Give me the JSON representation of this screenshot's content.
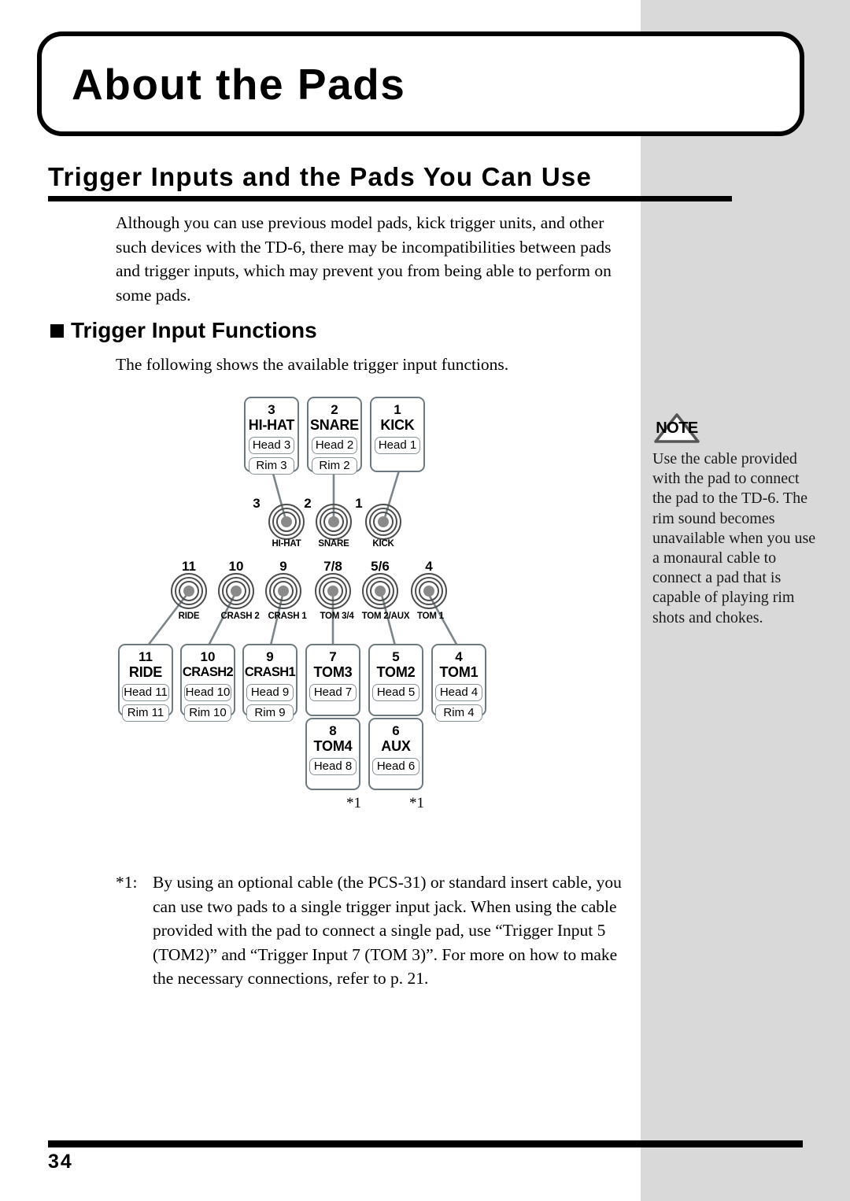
{
  "page": {
    "chapter_title": "About the Pads",
    "section_title": "Trigger Inputs and the Pads You Can Use",
    "page_number": "34"
  },
  "intro": {
    "paragraph": "Although you can use previous model pads, kick trigger units, and other such devices with the TD-6, there may be incompatibilities between pads and trigger inputs, which may prevent you from being able to perform on some pads."
  },
  "subsection": {
    "heading": "Trigger Input Functions",
    "paragraph": "The following shows the available trigger input functions."
  },
  "note": {
    "icon_label": "NOTE",
    "text": "Use the cable provided with the pad to connect the pad to the TD-6. The rim sound becomes unavailable when you use a monaural cable to connect a pad that is capable of playing rim shots and chokes."
  },
  "diagram": {
    "top_boxes": [
      {
        "num": "3",
        "name": "HI-HAT",
        "pills": [
          "Head 3",
          "Rim 3"
        ]
      },
      {
        "num": "2",
        "name": "SNARE",
        "pills": [
          "Head 2",
          "Rim 2"
        ]
      },
      {
        "num": "1",
        "name": "KICK",
        "pills": [
          "Head 1"
        ]
      }
    ],
    "top_jacks": [
      {
        "num": "3",
        "label": "HI-HAT"
      },
      {
        "num": "2",
        "label": "SNARE"
      },
      {
        "num": "1",
        "label": "KICK"
      }
    ],
    "bottom_jacks": [
      {
        "num": "11",
        "label": "RIDE"
      },
      {
        "num": "10",
        "label": "CRASH 2"
      },
      {
        "num": "9",
        "label": "CRASH 1"
      },
      {
        "num": "7/8",
        "label": "TOM 3/4"
      },
      {
        "num": "5/6",
        "label": "TOM 2/AUX"
      },
      {
        "num": "4",
        "label": "TOM 1"
      }
    ],
    "bottom_boxes": [
      {
        "num": "11",
        "name": "RIDE",
        "pills": [
          "Head 11",
          "Rim 11"
        ]
      },
      {
        "num": "10",
        "name": "CRASH2",
        "pills": [
          "Head 10",
          "Rim 10"
        ]
      },
      {
        "num": "9",
        "name": "CRASH1",
        "pills": [
          "Head 9",
          "Rim 9"
        ]
      },
      {
        "num": "7",
        "name": "TOM3",
        "pills": [
          "Head 7"
        ]
      },
      {
        "num": "5",
        "name": "TOM2",
        "pills": [
          "Head 5"
        ]
      },
      {
        "num": "4",
        "name": "TOM1",
        "pills": [
          "Head 4",
          "Rim 4"
        ]
      }
    ],
    "sub_boxes": [
      {
        "num": "8",
        "name": "TOM4",
        "pills": [
          "Head 8"
        ]
      },
      {
        "num": "6",
        "name": "AUX",
        "pills": [
          "Head 6"
        ]
      }
    ],
    "footnote_markers": [
      "*1",
      "*1"
    ]
  },
  "footnote": {
    "mark": "*1:",
    "text": "By using an optional cable (the PCS-31) or standard insert cable, you can use two pads to a single trigger input jack. When using the cable provided with the pad to connect a single pad, use “Trigger Input 5 (TOM2)” and “Trigger Input 7 (TOM 3)”. For more on how to make the necessary connections, refer to p. 21."
  },
  "colors": {
    "panel_grey": "#d9d9d9",
    "box_border": "#6e7a80",
    "jack_ring": "#4d4d4d",
    "jack_center": "#8a8a8a",
    "rule_black": "#000000"
  }
}
